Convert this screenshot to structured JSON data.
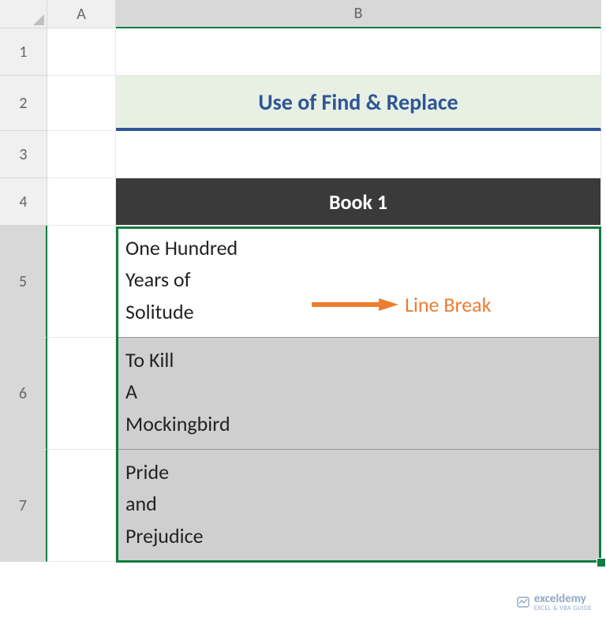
{
  "columns": {
    "A": "A",
    "B": "B"
  },
  "rows": {
    "r1": "1",
    "r2": "2",
    "r3": "3",
    "r4": "4",
    "r5": "5",
    "r6": "6",
    "r7": "7"
  },
  "title": "Use of Find & Replace",
  "table_header": "Book 1",
  "books": [
    "One Hundred\nYears of\nSolitude",
    "To Kill\nA\nMockingbird",
    "Pride\nand\nPrejudice"
  ],
  "annotation_label": "Line Break",
  "watermark": {
    "name": "exceldemy",
    "tag": "EXCEL & VBA GUIDE"
  }
}
